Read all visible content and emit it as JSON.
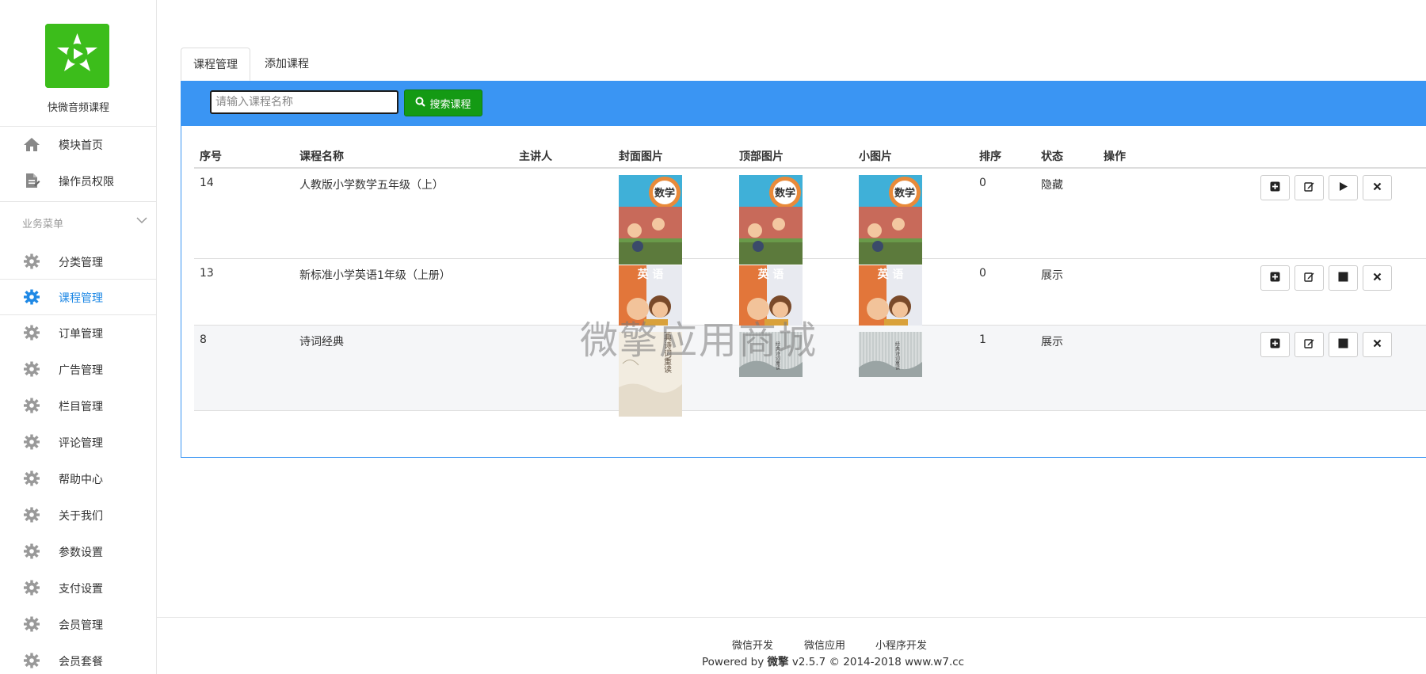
{
  "app": {
    "name": "快微音频课程",
    "brand_color": "#3cbd1b",
    "accent_color": "#3a95f3"
  },
  "sidebar": {
    "top_items": [
      {
        "label": "模块首页",
        "icon": "home-icon"
      },
      {
        "label": "操作员权限",
        "icon": "document-icon"
      }
    ],
    "group_title": "业务菜单",
    "items": [
      {
        "label": "分类管理",
        "icon": "gear-icon"
      },
      {
        "label": "课程管理",
        "icon": "gear-icon",
        "active": true
      },
      {
        "label": "订单管理",
        "icon": "gear-icon"
      },
      {
        "label": "广告管理",
        "icon": "gear-icon"
      },
      {
        "label": "栏目管理",
        "icon": "gear-icon"
      },
      {
        "label": "评论管理",
        "icon": "gear-icon"
      },
      {
        "label": "帮助中心",
        "icon": "gear-icon"
      },
      {
        "label": "关于我们",
        "icon": "gear-icon"
      },
      {
        "label": "参数设置",
        "icon": "gear-icon"
      },
      {
        "label": "支付设置",
        "icon": "gear-icon"
      },
      {
        "label": "会员管理",
        "icon": "gear-icon"
      },
      {
        "label": "会员套餐",
        "icon": "gear-icon"
      }
    ]
  },
  "tabs": [
    {
      "label": "课程管理",
      "active": true
    },
    {
      "label": "添加课程",
      "active": false
    }
  ],
  "search": {
    "placeholder": "请输入课程名称",
    "value": "",
    "button_label": "搜索课程"
  },
  "table": {
    "headers": [
      "序号",
      "课程名称",
      "主讲人",
      "封面图片",
      "顶部图片",
      "小图片",
      "排序",
      "状态",
      "操作"
    ],
    "rows": [
      {
        "id": "14",
        "name": "人教版小学数学五年级（上）",
        "lecturer": "",
        "sort": "0",
        "status": "隐藏",
        "toggle_icon": "play-icon",
        "cover": "math",
        "top": "math",
        "small": "math"
      },
      {
        "id": "13",
        "name": "新标准小学英语1年级（上册）",
        "lecturer": "",
        "sort": "0",
        "status": "展示",
        "toggle_icon": "stop-icon",
        "cover": "english",
        "top": "english",
        "small": "english"
      },
      {
        "id": "8",
        "name": "诗词经典",
        "lecturer": "",
        "sort": "1",
        "status": "展示",
        "toggle_icon": "stop-icon",
        "cover": "poetry",
        "top": "poetry-grey",
        "small": "poetry-grey"
      }
    ],
    "action_icons": [
      "plus-square-icon",
      "edit-icon",
      "toggle-icon",
      "delete-icon"
    ],
    "cover_texts": {
      "math": "数学",
      "english": "英 语",
      "poetry": "经典诗词重读"
    }
  },
  "watermark": "微擎应用商城",
  "footer": {
    "links": [
      "微信开发",
      "微信应用",
      "小程序开发"
    ],
    "powered_prefix": "Powered by ",
    "powered_brand": "微擎",
    "powered_suffix": " v2.5.7 © 2014-2018 www.w7.cc"
  }
}
